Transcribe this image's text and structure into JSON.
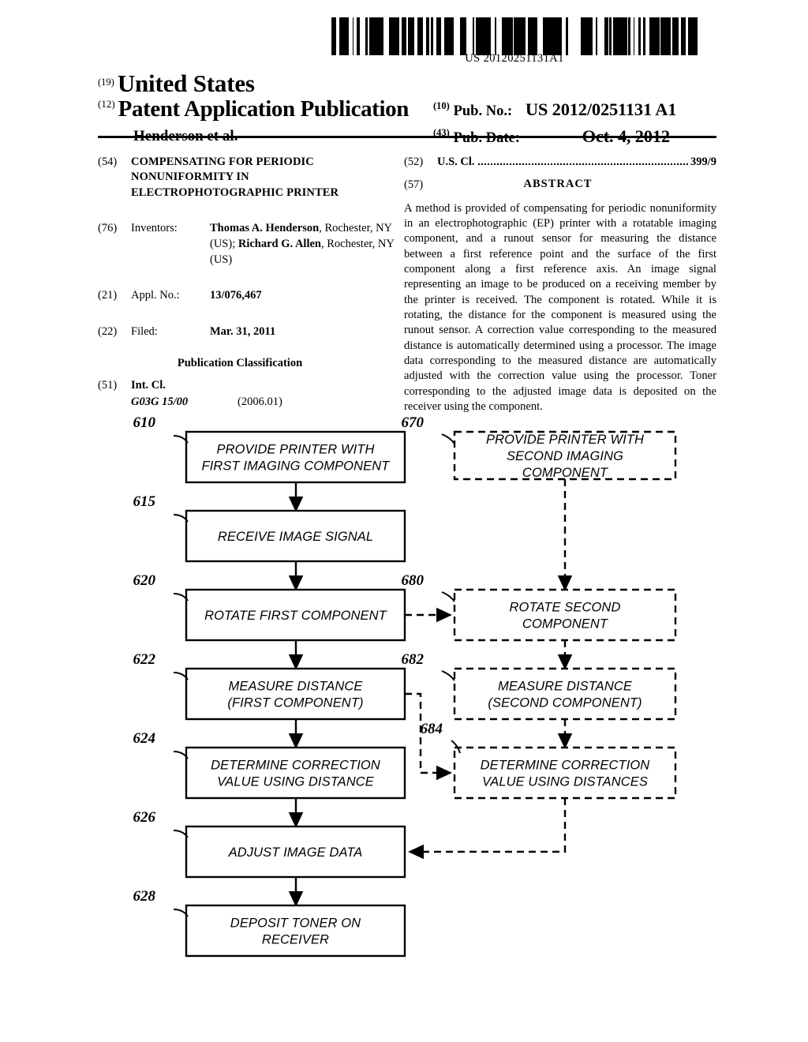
{
  "barcode": {
    "number": "US 20120251131A1"
  },
  "masthead": {
    "inid_19": "(19)",
    "country": "United States",
    "inid_12": "(12)",
    "doc_type": "Patent Application Publication",
    "authors": "Henderson et al.",
    "inid_10": "(10)",
    "pub_no_label": "Pub. No.:",
    "pub_no_value": "US 2012/0251131 A1",
    "inid_43": "(43)",
    "pub_date_label": "Pub. Date:",
    "pub_date_value": "Oct. 4, 2012"
  },
  "left_column": {
    "title_inid": "(54)",
    "title": "COMPENSATING FOR PERIODIC NONUNIFORMITY IN ELECTROPHOTOGRAPHIC PRINTER",
    "inventors_inid": "(76)",
    "inventors_label": "Inventors:",
    "inventor_1_name": "Thomas A. Henderson",
    "inventor_1_city": ", Rochester, NY (US); ",
    "inventor_2_name": "Richard G. Allen",
    "inventor_2_city": ", Rochester, NY (US)",
    "appl_inid": "(21)",
    "appl_label": "Appl. No.:",
    "appl_value": "13/076,467",
    "filed_inid": "(22)",
    "filed_label": "Filed:",
    "filed_value": "Mar. 31, 2011",
    "pub_class_heading": "Publication Classification",
    "intcl_inid": "(51)",
    "intcl_label": "Int. Cl.",
    "intcl_code": "G03G 15/00",
    "intcl_year": "(2006.01)"
  },
  "right_column": {
    "uscl_inid": "(52)",
    "uscl_label": "U.S. Cl.",
    "uscl_value": "399/9",
    "abstract_inid": "(57)",
    "abstract_label": "ABSTRACT",
    "abstract_text": "A method is provided of compensating for periodic nonuniformity in an electrophotographic (EP) printer with a rotatable imaging component, and a runout sensor for measuring the distance between a first reference point and the surface of the first component along a first reference axis. An image signal representing an image to be produced on a receiving member by the printer is received. The component is rotated. While it is rotating, the distance for the component is measured using the runout sensor. A correction value corresponding to the measured distance is automatically determined using a processor. The image data corresponding to the measured distance are automatically adjusted with the correction value using the processor. Toner corresponding to the adjusted image data is deposited on the receiver using the component."
  },
  "flowchart": {
    "nodes": [
      {
        "ref": "610",
        "style": "solid",
        "lines": [
          "PROVIDE PRINTER WITH",
          "FIRST IMAGING COMPONENT"
        ]
      },
      {
        "ref": "615",
        "style": "solid",
        "lines": [
          "RECEIVE IMAGE SIGNAL"
        ]
      },
      {
        "ref": "620",
        "style": "solid",
        "lines": [
          "ROTATE FIRST COMPONENT"
        ]
      },
      {
        "ref": "622",
        "style": "solid",
        "lines": [
          "MEASURE DISTANCE",
          "(FIRST COMPONENT)"
        ]
      },
      {
        "ref": "624",
        "style": "solid",
        "lines": [
          "DETERMINE CORRECTION",
          "VALUE USING DISTANCE"
        ]
      },
      {
        "ref": "626",
        "style": "solid",
        "lines": [
          "ADJUST IMAGE DATA"
        ]
      },
      {
        "ref": "628",
        "style": "solid",
        "lines": [
          "DEPOSIT TONER ON",
          "RECEIVER"
        ]
      },
      {
        "ref": "670",
        "style": "dashed",
        "lines": [
          "PROVIDE PRINTER WITH",
          "SECOND IMAGING",
          "COMPONENT"
        ]
      },
      {
        "ref": "680",
        "style": "dashed",
        "lines": [
          "ROTATE SECOND",
          "COMPONENT"
        ]
      },
      {
        "ref": "682",
        "style": "dashed",
        "lines": [
          "MEASURE DISTANCE",
          "(SECOND COMPONENT)"
        ]
      },
      {
        "ref": "684",
        "style": "dashed",
        "lines": [
          "DETERMINE CORRECTION",
          "VALUE USING DISTANCES"
        ]
      }
    ]
  }
}
